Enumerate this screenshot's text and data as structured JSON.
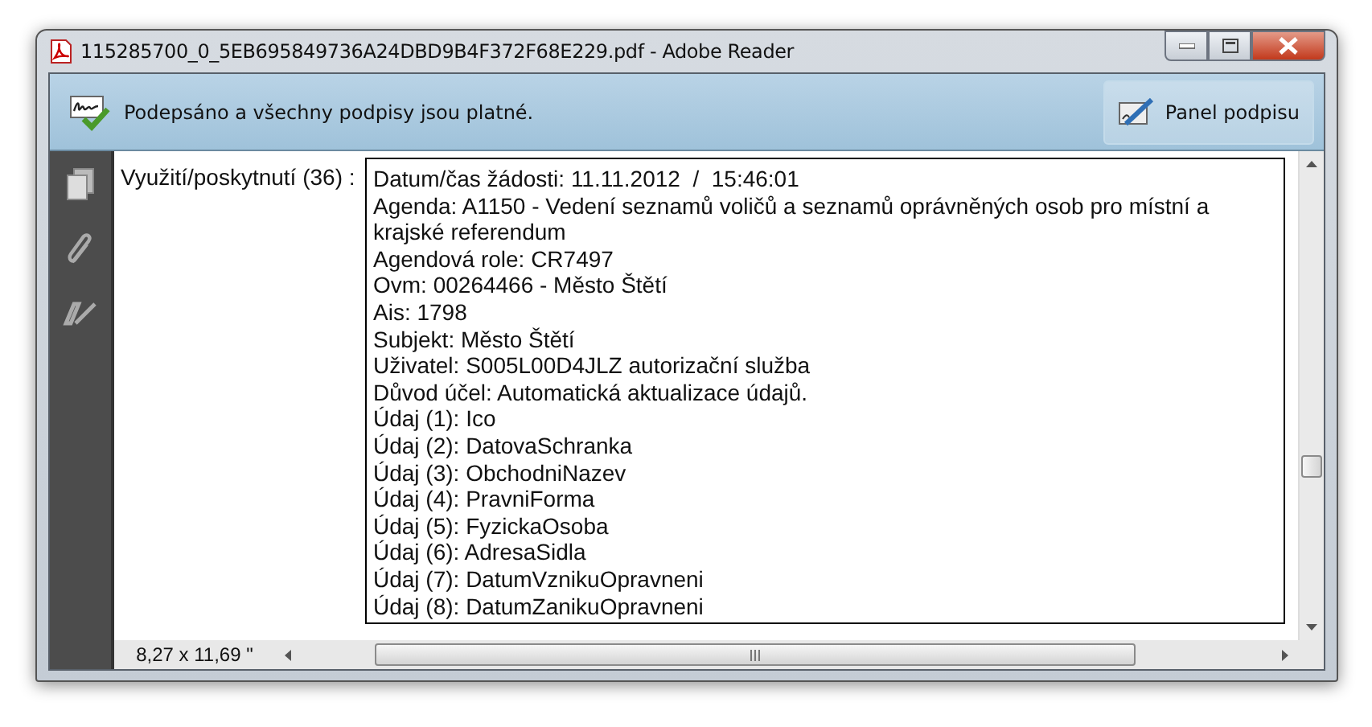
{
  "window": {
    "title": "115285700_0_5EB695849736A24DBD9B4F372F68E229.pdf - Adobe Reader"
  },
  "signature_bar": {
    "message": "Podepsáno a všechny podpisy jsou platné.",
    "button": "Panel podpisu"
  },
  "document": {
    "field_label": "Využití/poskytnutí (36) :",
    "lines": [
      "Datum/čas žádosti: 11.11.2012  /  15:46:01",
      "Agenda: A1150 - Vedení seznamů voličů a seznamů oprávněných osob pro místní a krajské referendum",
      "Agendová role: CR7497",
      "Ovm: 00264466 - Město Štětí",
      "Ais: 1798",
      "Subjekt: Město Štětí",
      "Uživatel: S005L00D4JLZ autorizační služba",
      "Důvod účel: Automatická aktualizace údajů.",
      "Údaj (1): Ico",
      "Údaj (2): DatovaSchranka",
      "Údaj (3): ObchodniNazev",
      "Údaj (4): PravniForma",
      "Údaj (5): FyzickaOsoba",
      "Údaj (6): AdresaSidla",
      "Údaj (7): DatumVznikuOpravneni",
      "Údaj (8): DatumZanikuOpravneni"
    ]
  },
  "status_bar": {
    "page_size": "8,27 x 11,69 \""
  }
}
